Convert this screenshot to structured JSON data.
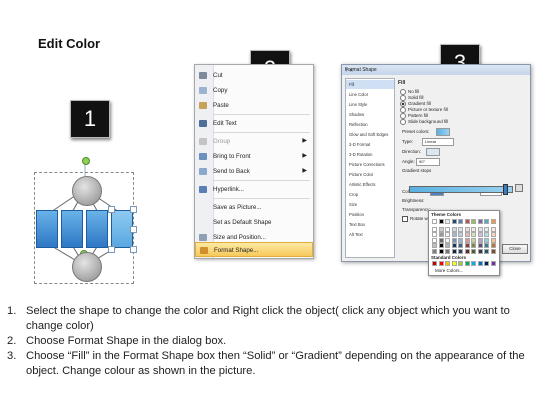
{
  "title": "Edit Color",
  "steps": [
    "1",
    "2",
    "3"
  ],
  "context_menu": {
    "items": [
      {
        "label": "Cut",
        "icon": "scissors-icon",
        "disabled": false,
        "submenu": false
      },
      {
        "label": "Copy",
        "icon": "copy-icon",
        "disabled": false,
        "submenu": false
      },
      {
        "label": "Paste",
        "icon": "paste-icon",
        "disabled": false,
        "submenu": false
      },
      {
        "label": "Edit Text",
        "icon": "edit-text-icon",
        "disabled": false,
        "submenu": false
      },
      {
        "label": "Group",
        "icon": "group-icon",
        "disabled": true,
        "submenu": true
      },
      {
        "label": "Bring to Front",
        "icon": "bring-front-icon",
        "disabled": false,
        "submenu": true
      },
      {
        "label": "Send to Back",
        "icon": "send-back-icon",
        "disabled": false,
        "submenu": true
      },
      {
        "label": "Hyperlink...",
        "icon": "hyperlink-icon",
        "disabled": false,
        "submenu": false
      },
      {
        "label": "Save as Picture...",
        "icon": "",
        "disabled": false,
        "submenu": false
      },
      {
        "label": "Set as Default Shape",
        "icon": "",
        "disabled": false,
        "submenu": false
      },
      {
        "label": "Size and Position...",
        "icon": "size-position-icon",
        "disabled": false,
        "submenu": false
      },
      {
        "label": "Format Shape...",
        "icon": "format-shape-icon",
        "disabled": false,
        "submenu": false,
        "highlighted": true
      }
    ]
  },
  "dialog": {
    "title": "Format Shape",
    "title_buttons": "? ✕",
    "nav": [
      "Fill",
      "Line Color",
      "Line Style",
      "Shadow",
      "Reflection",
      "Glow and Soft Edges",
      "3-D Format",
      "3-D Rotation",
      "Picture Corrections",
      "Picture Color",
      "Artistic Effects",
      "Crop",
      "Size",
      "Position",
      "Text Box",
      "Alt Text"
    ],
    "section": "Fill",
    "options": [
      "No fill",
      "Solid fill",
      "Gradient fill",
      "Picture or texture fill",
      "Pattern fill",
      "Slide background fill"
    ],
    "selected_option": 2,
    "preset_colors": "Preset colors:",
    "type_label": "Type:",
    "type_value": "Linear",
    "direction_label": "Direction:",
    "angle_label": "Angle:",
    "angle_value": "90°",
    "gradient_stops": "Gradient stops",
    "color_label": "Color",
    "position_label": "Position:",
    "position_value": "100%",
    "brightness_label": "Brightness:",
    "transparency_label": "Transparency:",
    "rotate_label": "Rotate with shape",
    "close": "Close"
  },
  "palette": {
    "theme_label": "Theme Colors",
    "standard_label": "Standard Colors",
    "more_label": "More Colors...",
    "theme_top": [
      "#ffffff",
      "#000000",
      "#eeece1",
      "#1f497d",
      "#4f81bd",
      "#c0504d",
      "#9bbb59",
      "#8064a2",
      "#4bacc6",
      "#f79646"
    ],
    "standard": [
      "#c00000",
      "#ff0000",
      "#ffc000",
      "#ffff00",
      "#92d050",
      "#00b050",
      "#00b0f0",
      "#0070c0",
      "#002060",
      "#7030a0"
    ]
  },
  "instructions": [
    {
      "num": "1.",
      "text": "Select the shape to change the color and Right click the object( click any object which you want to change color)"
    },
    {
      "num": "2.",
      "text": "Choose Format Shape in the dialog box."
    },
    {
      "num": "3.",
      "text": "Choose “Fill” in the Format Shape box then “Solid” or “Gradient” depending on the appearance of the object. Change colour as shown in the picture."
    }
  ]
}
